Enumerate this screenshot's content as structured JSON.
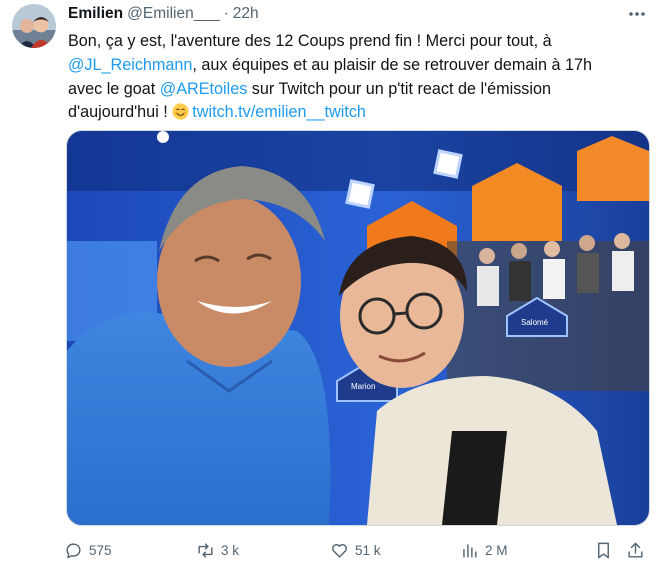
{
  "tweet": {
    "display_name": "Emilien",
    "handle": "@Emilien___",
    "separator": "·",
    "timestamp": "22h",
    "text": {
      "line1": "Bon, ça y est, l'aventure des 12 Coups prend fin ! Merci pour tout, à",
      "mention1": "@JL_Reichmann",
      "line2_rest": ", aux équipes et au plaisir de se retrouver demain à 17h",
      "line3_pre": "avec le goat ",
      "mention2": "@AREtoiles",
      "line3_post": " sur Twitch pour un p'tit react de l'émission",
      "line4_pre": "d'aujourd'hui ! ",
      "link": "twitch.tv/emilien__twitch"
    },
    "media": {
      "studio_name_tags": [
        "Marion",
        "Salomé"
      ]
    }
  },
  "actions": {
    "replies": "575",
    "retweets": "3 k",
    "likes": "51 k",
    "views": "2 M"
  },
  "icons": {
    "more": "more-horizontal-icon",
    "reply": "speech-bubble-icon",
    "retweet": "retweet-arrows-icon",
    "like": "heart-icon",
    "views": "bar-chart-icon",
    "bookmark": "bookmark-icon",
    "share": "share-upload-icon",
    "emoji": "smiling-face-emoji"
  },
  "colors": {
    "link": "#1d9bf0",
    "secondary_text": "#536471",
    "primary_text": "#0f1419"
  }
}
